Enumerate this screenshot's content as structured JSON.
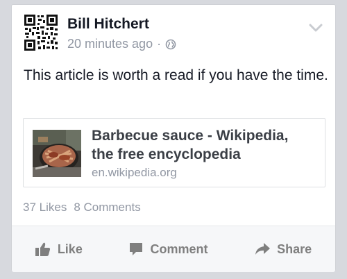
{
  "post": {
    "author": "Bill Hitchert",
    "timestamp": "20 minutes ago",
    "separator": "·",
    "audience_icon": "globe-icon",
    "text": "This article is worth a read if you have the time."
  },
  "link_preview": {
    "title": "Barbecue sauce - Wikipedia, the free encyclopedia",
    "domain": "en.wikipedia.org"
  },
  "stats": {
    "likes": "37 Likes",
    "comments": "8 Comments"
  },
  "actions": {
    "like_label": "Like",
    "comment_label": "Comment",
    "share_label": "Share"
  },
  "colors": {
    "background": "#d7d9de",
    "card": "#ffffff",
    "name": "#141823",
    "muted": "#9197a3",
    "action_text": "#7f7f7f"
  }
}
